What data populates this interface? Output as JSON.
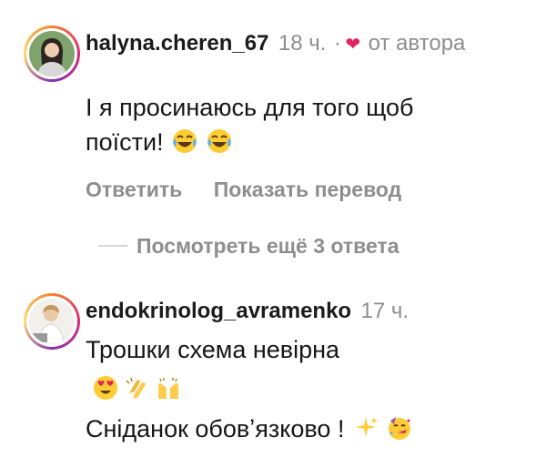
{
  "comments": [
    {
      "username": "halyna.cheren_67",
      "time": "18 ч.",
      "separator": "·",
      "liked_by_author_label": "от автора",
      "text_line1": "І я просинаюсь для того щоб",
      "text_line2": "поїсти!",
      "emojis": [
        "laughing-tears",
        "laughing-tears"
      ],
      "actions": {
        "reply": "Ответить",
        "translate": "Показать перевод"
      },
      "view_replies": "Посмотреть ещё 3 ответа"
    },
    {
      "username": "endokrinolog_avramenko",
      "time": "17 ч.",
      "text_line1": "Трошки схема невірна",
      "emojis_line2": [
        "heart-eyes",
        "clapping-hands",
        "raising-hands"
      ],
      "text_line3": "Сніданок обовʼязково !",
      "emojis_line3": [
        "sparkles",
        "partying-face"
      ]
    }
  ],
  "colors": {
    "muted": "#8e8e8e",
    "heart": "#e0245e",
    "text": "#161616"
  }
}
